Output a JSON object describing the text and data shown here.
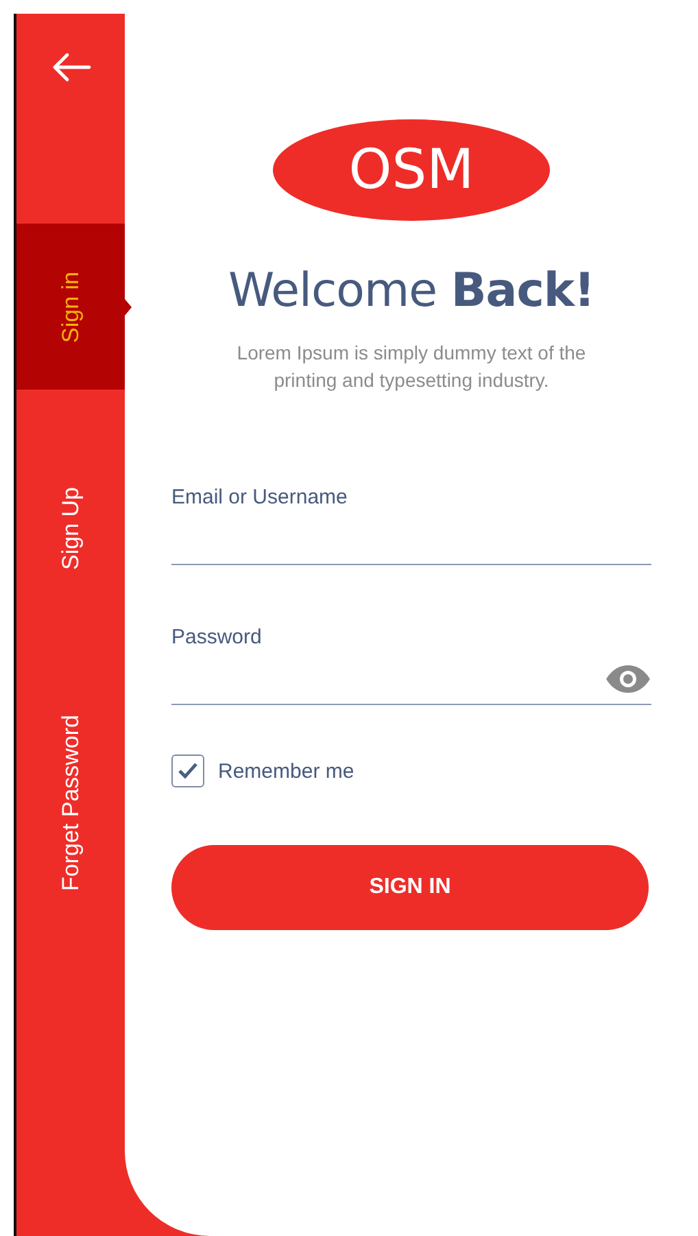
{
  "sidebar": {
    "tabs": [
      {
        "label": "Sign in",
        "selected": true
      },
      {
        "label": "Sign Up",
        "selected": false
      },
      {
        "label": "Forget Password",
        "selected": false
      }
    ]
  },
  "logo": {
    "text": "OSM"
  },
  "heading": "Welcome **Back!**",
  "subtitle": "Lorem Ipsum is simply dummy text of the printing and typesetting industry.",
  "fields": [
    {
      "label": "Email or Username",
      "kind": "text"
    },
    {
      "label": "Password",
      "kind": "password"
    }
  ],
  "remember": {
    "label": "Remember me",
    "checked": true
  },
  "submit": {
    "label": "SIGN IN"
  }
}
